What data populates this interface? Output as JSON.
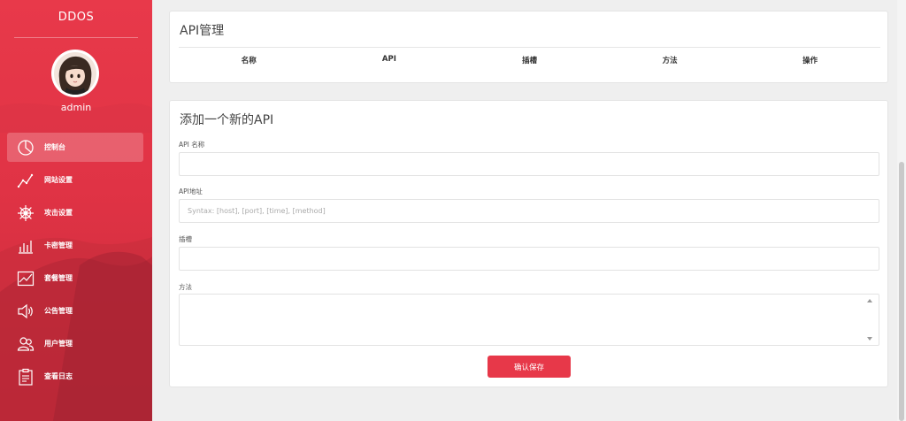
{
  "sidebar": {
    "brand": "DDOS",
    "username": "admin",
    "items": [
      {
        "label": "控制台",
        "icon": "pie-chart-icon",
        "active": true
      },
      {
        "label": "网站设置",
        "icon": "line-graph-icon",
        "active": false
      },
      {
        "label": "攻击设置",
        "icon": "ship-wheel-icon",
        "active": false
      },
      {
        "label": "卡密管理",
        "icon": "bar-chart-icon",
        "active": false
      },
      {
        "label": "套餐管理",
        "icon": "trend-chart-icon",
        "active": false
      },
      {
        "label": "公告管理",
        "icon": "speaker-icon",
        "active": false
      },
      {
        "label": "用户管理",
        "icon": "users-icon",
        "active": false
      },
      {
        "label": "查看日志",
        "icon": "clipboard-icon",
        "active": false
      }
    ]
  },
  "api_table": {
    "title": "API管理",
    "columns": [
      "名称",
      "API",
      "插槽",
      "方法",
      "操作"
    ]
  },
  "form": {
    "title": "添加一个新的API",
    "name_label": "API 名称",
    "name_value": "",
    "url_label": "API地址",
    "url_placeholder": "Syntax: [host], [port], [time], [method]",
    "slots_label": "插槽",
    "slots_value": "",
    "methods_label": "方法",
    "methods_value": "",
    "submit_label": "确认保存"
  },
  "colors": {
    "accent": "#e73849",
    "sidebar": "#e03345"
  }
}
